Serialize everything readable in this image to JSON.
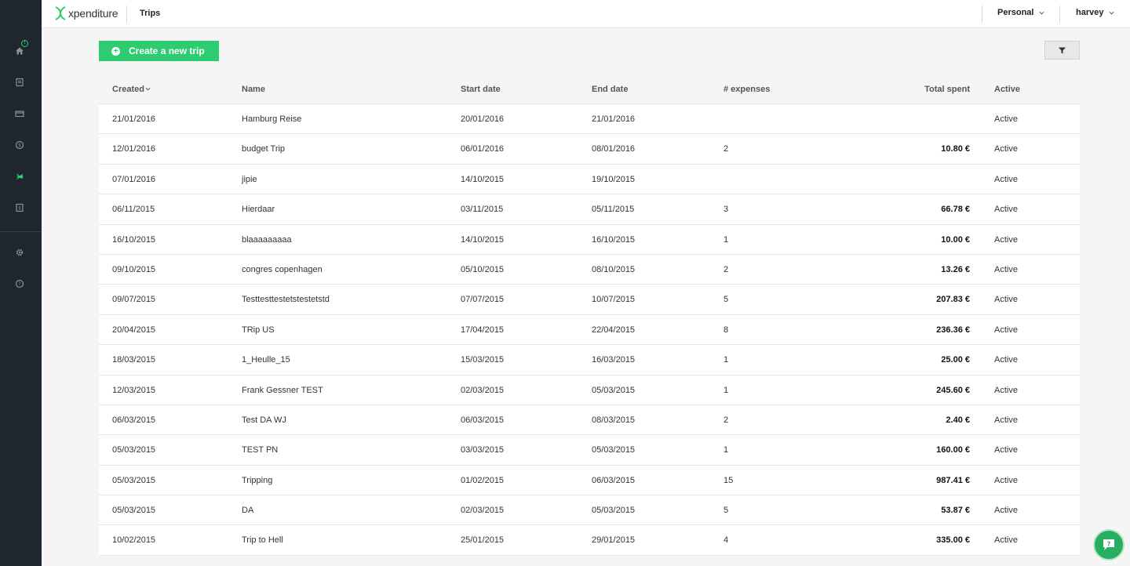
{
  "app": {
    "logo_text": "xpenditure",
    "page_title": "Trips"
  },
  "header": {
    "account_selector": "Personal",
    "user_menu": "harvey"
  },
  "sidebar": {
    "notification_count": "!",
    "items": [
      {
        "icon": "home-icon"
      },
      {
        "icon": "document-icon"
      },
      {
        "icon": "credit-card-icon"
      },
      {
        "icon": "dollar-icon"
      },
      {
        "icon": "plane-icon"
      },
      {
        "icon": "report-icon"
      },
      {
        "icon": "gear-icon"
      },
      {
        "icon": "help-icon"
      }
    ]
  },
  "toolbar": {
    "create_label": "Create a new trip",
    "filter_icon": "filter-icon"
  },
  "table": {
    "headers": {
      "created": "Created",
      "name": "Name",
      "start": "Start date",
      "end": "End date",
      "expenses": "# expenses",
      "total": "Total spent",
      "active": "Active"
    },
    "rows": [
      {
        "created": "21/01/2016",
        "name": "Hamburg Reise",
        "start": "20/01/2016",
        "end": "21/01/2016",
        "expenses": "",
        "total": "",
        "active": "Active"
      },
      {
        "created": "12/01/2016",
        "name": "budget Trip",
        "start": "06/01/2016",
        "end": "08/01/2016",
        "expenses": "2",
        "total": "10.80 €",
        "active": "Active"
      },
      {
        "created": "07/01/2016",
        "name": "jipie",
        "start": "14/10/2015",
        "end": "19/10/2015",
        "expenses": "",
        "total": "",
        "active": "Active"
      },
      {
        "created": "06/11/2015",
        "name": "Hierdaar",
        "start": "03/11/2015",
        "end": "05/11/2015",
        "expenses": "3",
        "total": "66.78 €",
        "active": "Active"
      },
      {
        "created": "16/10/2015",
        "name": "blaaaaaaaaa",
        "start": "14/10/2015",
        "end": "16/10/2015",
        "expenses": "1",
        "total": "10.00 €",
        "active": "Active"
      },
      {
        "created": "09/10/2015",
        "name": "congres copenhagen",
        "start": "05/10/2015",
        "end": "08/10/2015",
        "expenses": "2",
        "total": "13.26 €",
        "active": "Active"
      },
      {
        "created": "09/07/2015",
        "name": "Testtesttestetstestetstd",
        "start": "07/07/2015",
        "end": "10/07/2015",
        "expenses": "5",
        "total": "207.83 €",
        "active": "Active"
      },
      {
        "created": "20/04/2015",
        "name": "TRip US",
        "start": "17/04/2015",
        "end": "22/04/2015",
        "expenses": "8",
        "total": "236.36 €",
        "active": "Active"
      },
      {
        "created": "18/03/2015",
        "name": "1_Heulle_15",
        "start": "15/03/2015",
        "end": "16/03/2015",
        "expenses": "1",
        "total": "25.00 €",
        "active": "Active"
      },
      {
        "created": "12/03/2015",
        "name": "Frank Gessner TEST",
        "start": "02/03/2015",
        "end": "05/03/2015",
        "expenses": "1",
        "total": "245.60 €",
        "active": "Active"
      },
      {
        "created": "06/03/2015",
        "name": "Test DA WJ",
        "start": "06/03/2015",
        "end": "08/03/2015",
        "expenses": "2",
        "total": "2.40 €",
        "active": "Active"
      },
      {
        "created": "05/03/2015",
        "name": "TEST PN",
        "start": "03/03/2015",
        "end": "05/03/2015",
        "expenses": "1",
        "total": "160.00 €",
        "active": "Active"
      },
      {
        "created": "05/03/2015",
        "name": "Tripping",
        "start": "01/02/2015",
        "end": "06/03/2015",
        "expenses": "15",
        "total": "987.41 €",
        "active": "Active"
      },
      {
        "created": "05/03/2015",
        "name": "DA",
        "start": "02/03/2015",
        "end": "05/03/2015",
        "expenses": "5",
        "total": "53.87 €",
        "active": "Active"
      },
      {
        "created": "10/02/2015",
        "name": "Trip to Hell",
        "start": "25/01/2015",
        "end": "29/01/2015",
        "expenses": "4",
        "total": "335.00 €",
        "active": "Active"
      }
    ]
  },
  "chat": {
    "icon": "chat-help-icon"
  },
  "colors": {
    "accent": "#2ecc71",
    "sidebar_bg": "#1f262e"
  }
}
